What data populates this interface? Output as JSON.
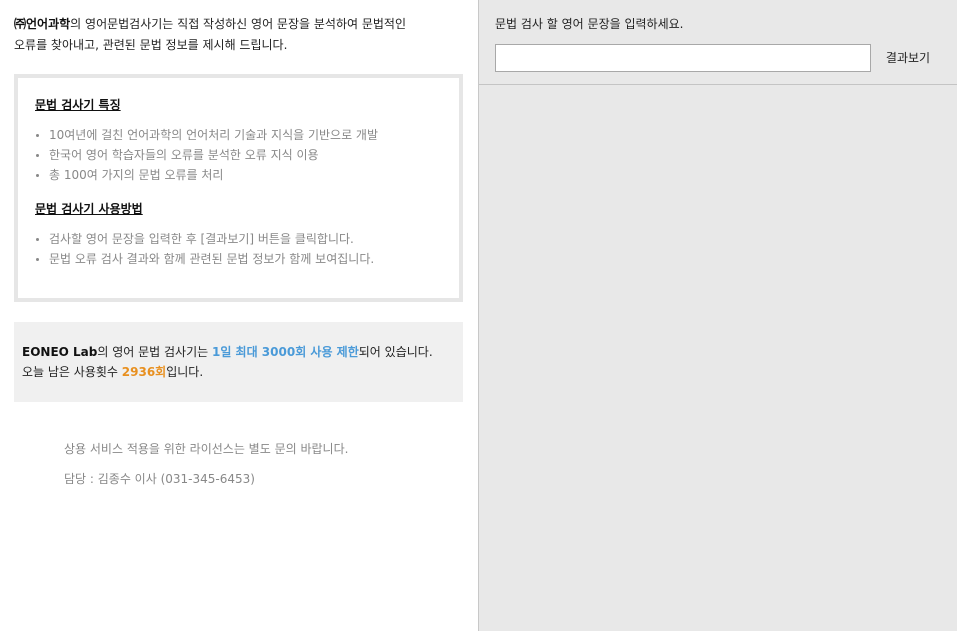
{
  "intro": {
    "company": "㈜언어과학",
    "line1_rest": "의 영어문법검사기는 직접 작성하신 영어 문장을 분석하여 문법적인",
    "line2": "오류를 찾아내고, 관련된 문법 정보를 제시해 드립니다."
  },
  "features": {
    "title": "문법 검사기 특징",
    "items": [
      "10여년에 걸친 언어과학의 언어처리 기술과 지식을 기반으로 개발",
      "한국어 영어 학습자들의 오류를 분석한 오류 지식 이용",
      "총 100여 가지의 문법 오류를 처리"
    ]
  },
  "usage": {
    "title": "문법 검사기 사용방법",
    "items": [
      "검사할 영어 문장을 입력한 후 [결과보기] 버튼을 클릭합니다.",
      "문법 오류 검사 결과와 함께 관련된 문법 정보가 함께 보여집니다."
    ]
  },
  "limit": {
    "lab": "EONEO Lab",
    "mid": "의 영어 문법 검사기는 ",
    "limit_text": "1일 최대 3000회 사용 제한",
    "end": "되어 있습니다.",
    "remaining_prefix": "오늘 남은 사용횟수 ",
    "remaining_value": "2936회",
    "remaining_suffix": "입니다."
  },
  "contact": {
    "license": "상용 서비스 적용을 위한 라이선스는 별도 문의 바랍니다.",
    "person": "담당 : 김종수 이사 (031-345-6453)"
  },
  "checker": {
    "prompt": "문법 검사 할 영어 문장을 입력하세요.",
    "input_value": "",
    "button_label": "결과보기"
  }
}
